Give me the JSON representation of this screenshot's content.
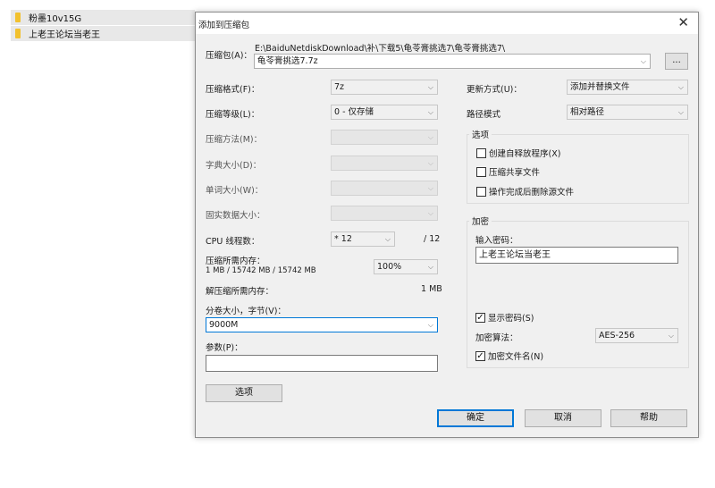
{
  "explorer": {
    "items": [
      {
        "label": "粉墨10v15G"
      },
      {
        "label": "上老王论坛当老王"
      }
    ]
  },
  "dialog": {
    "title": "添加到压缩包",
    "close_glyph": "✕",
    "archive_label": "压缩包(A)：",
    "archive_path": "E:\\BaiduNetdiskDownload\\补\\下载5\\龟苓膏挑选7\\龟苓膏挑选7\\",
    "archive_name": "龟苓膏挑选7.7z",
    "browse_label": "...",
    "left": {
      "format_label": "压缩格式(F)：",
      "format_value": "7z",
      "level_label": "压缩等级(L)：",
      "level_value": "0 - 仅存储",
      "method_label": "压缩方法(M)：",
      "dict_label": "字典大小(D)：",
      "word_label": "单词大小(W)：",
      "solid_label": "固实数据大小：",
      "cpu_label": "CPU 线程数：",
      "cpu_value": "* 12",
      "cpu_max": "/ 12",
      "mem_comp_label": "压缩所需内存：",
      "mem_comp_detail": "1 MB / 15742 MB / 15742 MB",
      "mem_percent": "100%",
      "mem_decomp_label": "解压缩所需内存：",
      "mem_decomp_value": "1 MB",
      "volume_label": "分卷大小，字节(V)：",
      "volume_value": "9000M",
      "params_label": "参数(P)：",
      "params_value": "",
      "options_button": "选项"
    },
    "right": {
      "update_label": "更新方式(U)：",
      "update_value": "添加并替换文件",
      "path_label": "路径模式",
      "path_value": "相对路径",
      "options_group": "选项",
      "opt_sfx": "创建自释放程序(X)",
      "opt_shared": "压缩共享文件",
      "opt_delete": "操作完成后删除源文件",
      "encrypt_group": "加密",
      "password_label": "输入密码：",
      "password_value": "上老王论坛当老王",
      "show_password": "显示密码(S)",
      "enc_method_label": "加密算法：",
      "enc_method_value": "AES-256",
      "encrypt_names": "加密文件名(N)",
      "check_mark": "✓"
    },
    "buttons": {
      "ok": "确定",
      "cancel": "取消",
      "help": "帮助"
    },
    "arrow_glyph": "⌵"
  }
}
